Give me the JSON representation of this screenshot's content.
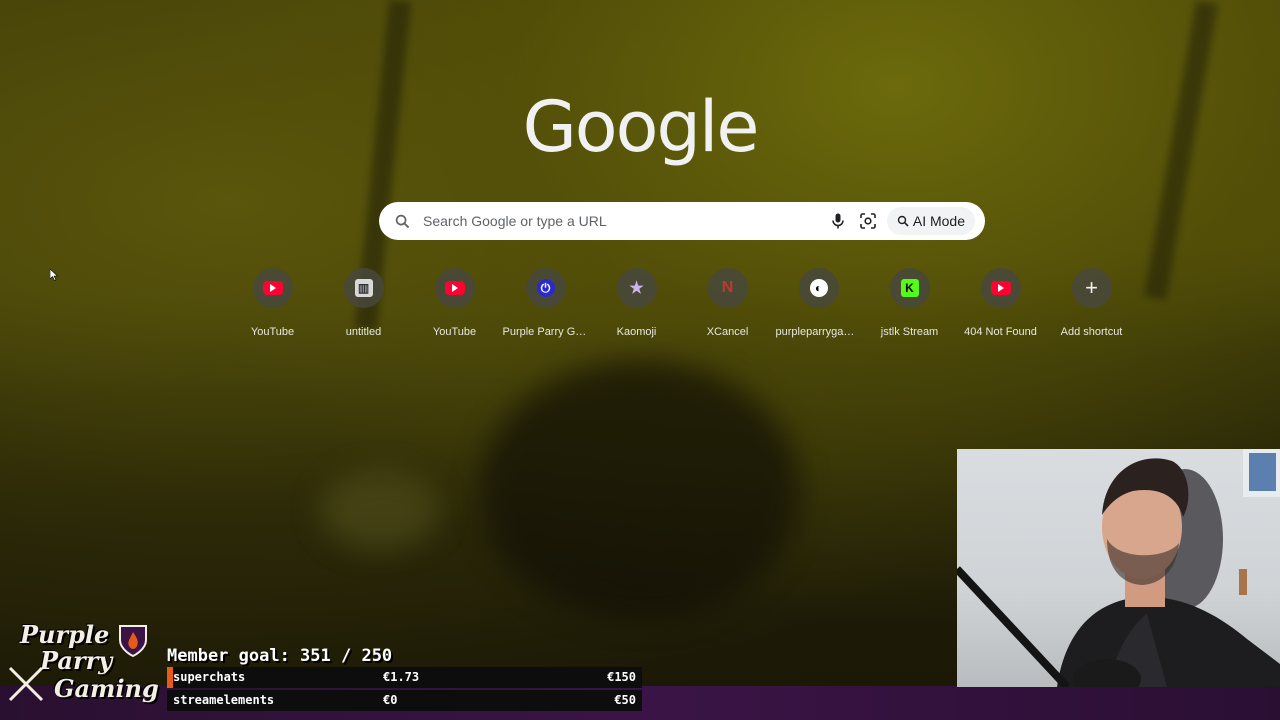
{
  "google": {
    "logo_text": "Google"
  },
  "search": {
    "placeholder": "Search Google or type a URL",
    "ai_mode_label": "AI Mode"
  },
  "shortcuts": [
    {
      "label": "YouTube",
      "icon": "youtube-icon"
    },
    {
      "label": "untitled",
      "icon": "untitled-page-icon"
    },
    {
      "label": "YouTube",
      "icon": "youtube-icon"
    },
    {
      "label": "Purple Parry Ga...",
      "icon": "purple-parry-icon"
    },
    {
      "label": "Kaomoji",
      "icon": "kaomoji-icon"
    },
    {
      "label": "XCancel",
      "icon": "xcancel-icon"
    },
    {
      "label": "purpleparrygam...",
      "icon": "purpleparry-dark-icon"
    },
    {
      "label": "jstlk Stream",
      "icon": "kick-icon"
    },
    {
      "label": "404 Not Found",
      "icon": "youtube-icon"
    },
    {
      "label": "Add shortcut",
      "icon": "plus-icon"
    }
  ],
  "overlay": {
    "brand": {
      "line1": "Purple",
      "line2": "Parry",
      "line3": "Gaming"
    },
    "member_goal": "Member goal: 351 / 250",
    "goals": [
      {
        "name": "superchats",
        "current": "€1.73",
        "target": "€150",
        "progress": 0.0115
      },
      {
        "name": "streamelements",
        "current": "€0",
        "target": "€50",
        "progress": 0
      }
    ]
  },
  "colors": {
    "accent_orange": "#e85a1a",
    "overlay_purple": "#3a1446",
    "youtube_red": "#ff0033",
    "kick_green": "#53fc18"
  }
}
